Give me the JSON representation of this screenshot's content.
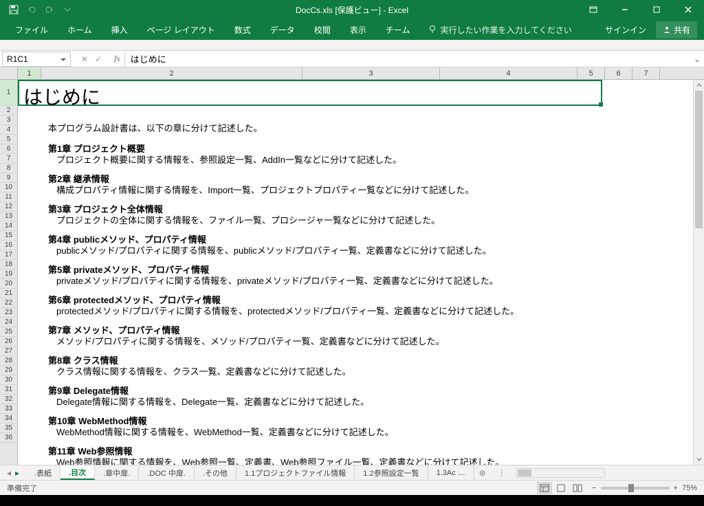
{
  "app": {
    "title": "DocCs.xls [保護ビュー] - Excel",
    "signin": "サインイン",
    "share": "共有"
  },
  "ribbon": {
    "tabs": [
      "ファイル",
      "ホーム",
      "挿入",
      "ページ レイアウト",
      "数式",
      "データ",
      "校閲",
      "表示",
      "チーム"
    ],
    "tellme": "実行したい作業を入力してください"
  },
  "namebox": "R1C1",
  "formula": "はじめに",
  "columns": [
    "1",
    "2",
    "3",
    "4",
    "5",
    "6",
    "7"
  ],
  "rows": [
    "1",
    "2",
    "3",
    "4",
    "5",
    "6",
    "7",
    "8",
    "9",
    "10",
    "11",
    "12",
    "13",
    "14",
    "15",
    "16",
    "17",
    "18",
    "19",
    "20",
    "21",
    "22",
    "23",
    "24",
    "25",
    "26",
    "27",
    "28",
    "29",
    "30",
    "31",
    "32",
    "33",
    "34",
    "35",
    "36"
  ],
  "doc": {
    "title": "はじめに",
    "intro": "本プログラム設計書は、以下の章に分けて記述した。",
    "chapters": [
      {
        "h": "第1章 プロジェクト概要",
        "d": "プロジェクト概要に関する情報を、参照設定一覧、AddIn一覧などに分けて記述した。"
      },
      {
        "h": "第2章 継承情報",
        "d": "構成プロパティ情報に関する情報を、Import一覧、プロジェクトプロパティ一覧などに分けて記述した。"
      },
      {
        "h": "第3章 プロジェクト全体情報",
        "d": "プロジェクトの全体に関する情報を、ファイル一覧、プロシージャ一覧などに分けて記述した。"
      },
      {
        "h": "第4章 publicメソッド、プロパティ情報",
        "d": "publicメソッド/プロパティに関する情報を、publicメソッド/プロパティ一覧、定義書などに分けて記述した。"
      },
      {
        "h": "第5章 privateメソッド、プロパティ情報",
        "d": "privateメソッド/プロパティに関する情報を、privateメソッド/プロパティ一覧、定義書などに分けて記述した。"
      },
      {
        "h": "第6章 protectedメソッド、プロパティ情報",
        "d": "protectedメソッド/プロパティに関する情報を、protectedメソッド/プロパティ一覧、定義書などに分けて記述した。"
      },
      {
        "h": "第7章 メソッド、プロパティ情報",
        "d": "メソッド/プロパティに関する情報を、メソッド/プロパティ一覧、定義書などに分けて記述した。"
      },
      {
        "h": "第8章 クラス情報",
        "d": "クラス情報に関する情報を、クラス一覧、定義書などに分けて記述した。"
      },
      {
        "h": "第9章 Delegate情報",
        "d": "Delegate情報に関する情報を、Delegate一覧、定義書などに分けて記述した。"
      },
      {
        "h": "第10章 WebMethod情報",
        "d": "WebMethod情報に関する情報を、WebMethod一覧、定義書などに分けて記述した。"
      },
      {
        "h": "第11章 Web参照情報",
        "d": "Web参照情報に関する情報を、Web参照一覧、定義書、Web参照ファイル一覧、定義書などに分けて記述した。"
      }
    ]
  },
  "sheets": [
    ".表紙",
    ".目次",
    ".章中扉.",
    ".DOC 中扉.",
    ".その他",
    "1.1プロジェクトファイル情報",
    "1.2参照設定一覧",
    "1.3Ac …"
  ],
  "active_sheet_index": 1,
  "status": {
    "ready": "準備完了",
    "zoom": "75%"
  }
}
